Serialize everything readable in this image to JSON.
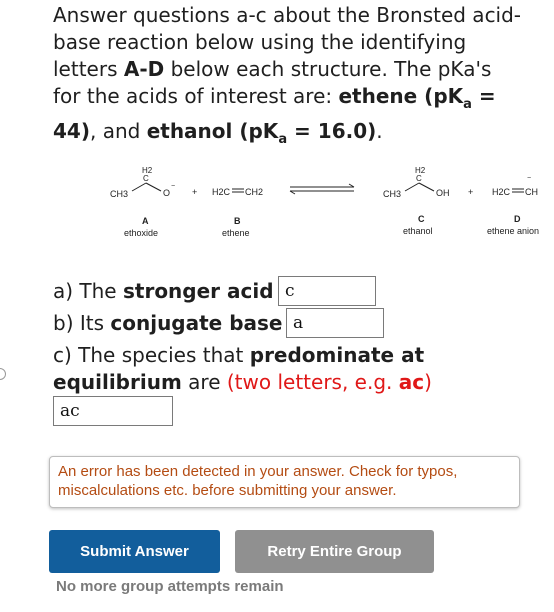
{
  "intro": {
    "line1": "Answer questions a-c about the Bronsted acid-base reaction below using the identifying letters ",
    "letters": "A-D",
    "line2": " below each structure. The pKa's for the acids of interest are: ",
    "acid1": "ethene (pK",
    "acid1_sub": "a",
    "acid1_val": " = 44)",
    "sep": ", and ",
    "acid2": "ethanol (pK",
    "acid2_sub": "a",
    "acid2_val": " = 16.0)",
    "end": "."
  },
  "scheme": {
    "A": {
      "letter": "A",
      "name": "ethoxide",
      "h2": "H2",
      "c": "C",
      "ch3": "CH3",
      "o": "O"
    },
    "B": {
      "letter": "B",
      "name": "ethene",
      "formula_left": "H2C",
      "formula_right": "CH2"
    },
    "C": {
      "letter": "C",
      "name": "ethanol",
      "h2": "H2",
      "c": "C",
      "ch3": "CH3",
      "oh": "OH"
    },
    "D": {
      "letter": "D",
      "name": "ethene anion",
      "formula_left": "H2C",
      "formula_right": "CH"
    },
    "plus": "+"
  },
  "questions": {
    "a_prefix": "a) The ",
    "a_bold": "stronger acid",
    "a_suffix": " is",
    "a_value": "c",
    "b_prefix": "b) Its ",
    "b_bold": "conjugate base",
    "b_suffix": " is",
    "b_value": "a",
    "c_prefix": "c) The species that ",
    "c_bold": "predominate at equilibrium",
    "c_suffix": " are ",
    "c_hint_prefix": "(two letters, e.g. ",
    "c_hint_bold": "ac",
    "c_hint_suffix": ")",
    "c_value": "ac"
  },
  "error_message": "An error has been detected in your answer. Check for typos, miscalculations etc. before submitting your answer.",
  "buttons": {
    "submit": "Submit Answer",
    "retry": "Retry Entire Group"
  },
  "status": "No more group attempts remain",
  "colors": {
    "submit_bg": "#125e9c",
    "retry_bg": "#909090",
    "error_text": "#b44c13",
    "hint_red": "#e01818"
  }
}
